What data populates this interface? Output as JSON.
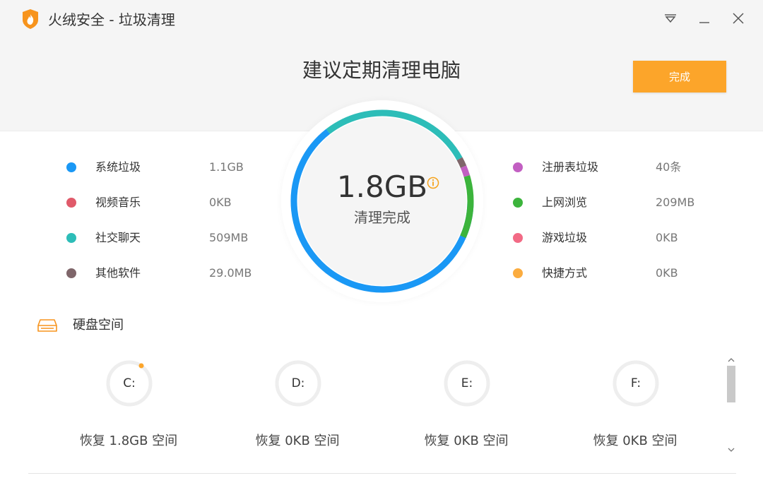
{
  "window": {
    "title": "火绒安全 - 垃圾清理"
  },
  "header": {
    "headline": "建议定期清理电脑",
    "done_button": "完成"
  },
  "gauge": {
    "value": "1.8GB",
    "label": "清理完成",
    "segments": [
      {
        "name": "系统垃圾",
        "fraction": 0.645,
        "color": "#1a98f5"
      },
      {
        "name": "社交聊天",
        "fraction": 0.275,
        "color": "#2dbdb8"
      },
      {
        "name": "其他软件",
        "fraction": 0.016,
        "color": "#7f666a"
      },
      {
        "name": "注册表垃圾",
        "fraction": 0.018,
        "color": "#c25fc2"
      },
      {
        "name": "上网浏览",
        "fraction": 0.112,
        "color": "#3cb43c"
      }
    ]
  },
  "categories_left": [
    {
      "name": "系统垃圾",
      "value": "1.1GB",
      "color": "#1a98f5"
    },
    {
      "name": "视频音乐",
      "value": "0KB",
      "color": "#e05a6a"
    },
    {
      "name": "社交聊天",
      "value": "509MB",
      "color": "#2dbdb8"
    },
    {
      "name": "其他软件",
      "value": "29.0MB",
      "color": "#7f666a"
    }
  ],
  "categories_right": [
    {
      "name": "注册表垃圾",
      "value": "40条",
      "color": "#c25fc2"
    },
    {
      "name": "上网浏览",
      "value": "209MB",
      "color": "#3cb43c"
    },
    {
      "name": "游戏垃圾",
      "value": "0KB",
      "color": "#f26a85"
    },
    {
      "name": "快捷方式",
      "value": "0KB",
      "color": "#fbac3f"
    }
  ],
  "disk": {
    "title": "硬盘空间",
    "drives": [
      {
        "letter": "C:",
        "label": "恢复 1.8GB 空间"
      },
      {
        "letter": "D:",
        "label": "恢复 0KB 空间"
      },
      {
        "letter": "E:",
        "label": "恢复 0KB 空间"
      },
      {
        "letter": "F:",
        "label": "恢复 0KB 空间"
      }
    ]
  },
  "colors": {
    "accent": "#fca52a",
    "ring_track": "#eeeeee"
  }
}
